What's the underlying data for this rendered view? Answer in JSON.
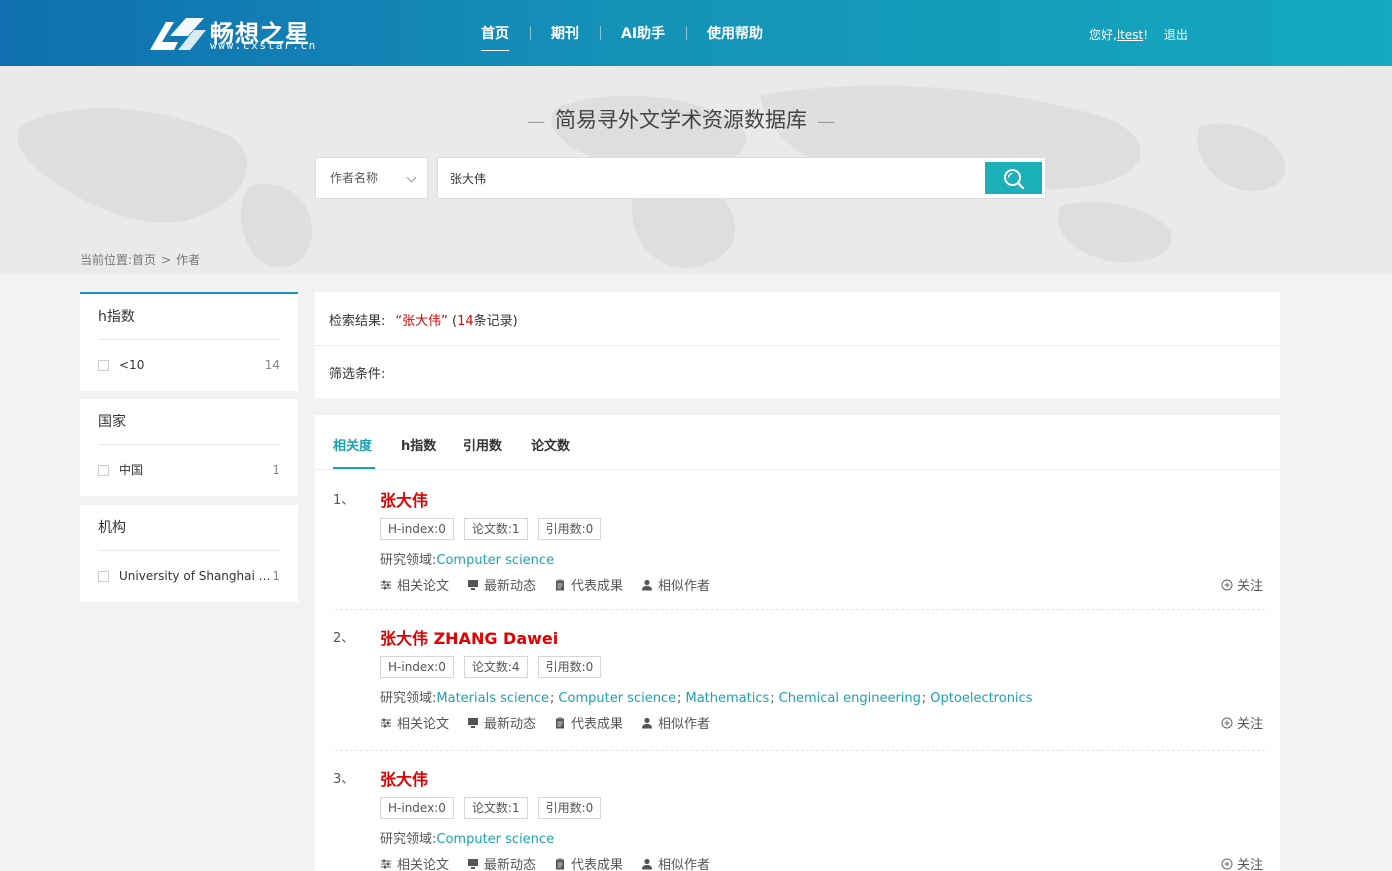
{
  "header": {
    "logo_name": "畅想之星",
    "logo_url": "www.cxstar.cn",
    "nav": [
      {
        "label": "首页",
        "active": true
      },
      {
        "label": "期刊",
        "active": false
      },
      {
        "label": "AI助手",
        "active": false
      },
      {
        "label": "使用帮助",
        "active": false
      }
    ],
    "greeting": "您好,",
    "username": "ltest",
    "exclaim": "!",
    "logout": "退出"
  },
  "hero": {
    "title": "简易寻外文学术资源数据库",
    "search_type": "作者名称",
    "search_value": "张大伟"
  },
  "breadcrumb": {
    "prefix": "当前位置:",
    "home": "首页",
    "separator": ">",
    "current": "作者"
  },
  "facets": [
    {
      "title": "h指数",
      "items": [
        {
          "label": "<10",
          "count": "14"
        }
      ]
    },
    {
      "title": "国家",
      "items": [
        {
          "label": "中国",
          "count": "1"
        }
      ]
    },
    {
      "title": "机构",
      "items": [
        {
          "label": "University of Shanghai for Science and Technology",
          "count": "1"
        }
      ]
    }
  ],
  "result_summary": {
    "prefix": "检索结果:",
    "keyword": "“张大伟”",
    "open": "(",
    "count": "14",
    "suffix": "条记录)",
    "filter_label": "筛选条件:"
  },
  "tabs": [
    "相关度",
    "h指数",
    "引用数",
    "论文数"
  ],
  "active_tab": "相关度",
  "accent_color": "#1aa3b3",
  "highlight_color": "#e20000",
  "actions": {
    "related_papers": "相关论文",
    "latest_news": "最新动态",
    "representative": "代表成果",
    "similar_authors": "相似作者",
    "follow": "关注"
  },
  "labels": {
    "field_prefix": "研究领域:"
  },
  "results": [
    {
      "index": "1、",
      "name": "张大伟",
      "stats": {
        "h_index": "H-index:0",
        "papers": "论文数:1",
        "citations": "引用数:0"
      },
      "fields": [
        "Computer science"
      ]
    },
    {
      "index": "2、",
      "name": "张大伟 ZHANG Dawei",
      "stats": {
        "h_index": "H-index:0",
        "papers": "论文数:4",
        "citations": "引用数:0"
      },
      "fields": [
        "Materials science",
        "Computer science",
        "Mathematics",
        "Chemical engineering",
        "Optoelectronics"
      ]
    },
    {
      "index": "3、",
      "name": "张大伟",
      "stats": {
        "h_index": "H-index:0",
        "papers": "论文数:1",
        "citations": "引用数:0"
      },
      "fields": [
        "Computer science"
      ]
    }
  ]
}
